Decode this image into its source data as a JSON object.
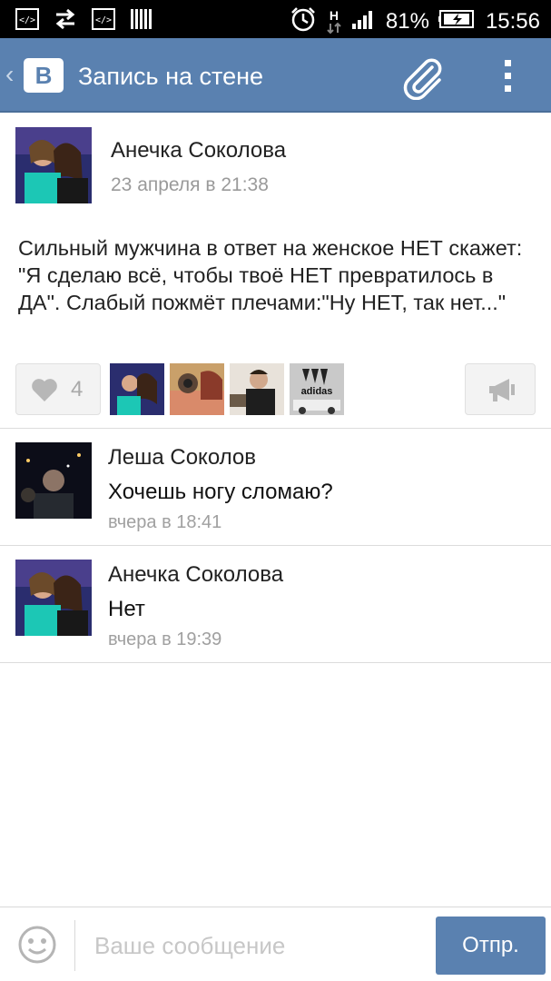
{
  "status_bar": {
    "battery_percent": "81%",
    "time": "15:56",
    "network_type": "H",
    "icons": [
      "code-icon",
      "transfer-arrows-icon",
      "code-icon",
      "barcode-icon",
      "alarm-icon",
      "signal-icon",
      "battery-icon"
    ]
  },
  "header": {
    "logo_text": "B",
    "title": "Запись на стене",
    "accent_color": "#5a81b0"
  },
  "post": {
    "author": "Анечка Соколова",
    "date": "23 апреля в 21:38",
    "text": "Сильный мужчина в ответ на женское НЕТ скажет: \"Я сделаю всё, чтобы твоё НЕТ превратилось в ДА\". Слабый пожмёт плечами:\"Ну НЕТ, так нет...\"",
    "like_count": "4"
  },
  "comments": [
    {
      "author": "Леша Соколов",
      "text": "Хочешь ногу сломаю?",
      "date": "вчера в 18:41"
    },
    {
      "author": "Анечка Соколова",
      "text": "Нет",
      "date": "вчера в 19:39"
    }
  ],
  "composer": {
    "placeholder": "Ваше сообщение",
    "send_label": "Отпр."
  }
}
